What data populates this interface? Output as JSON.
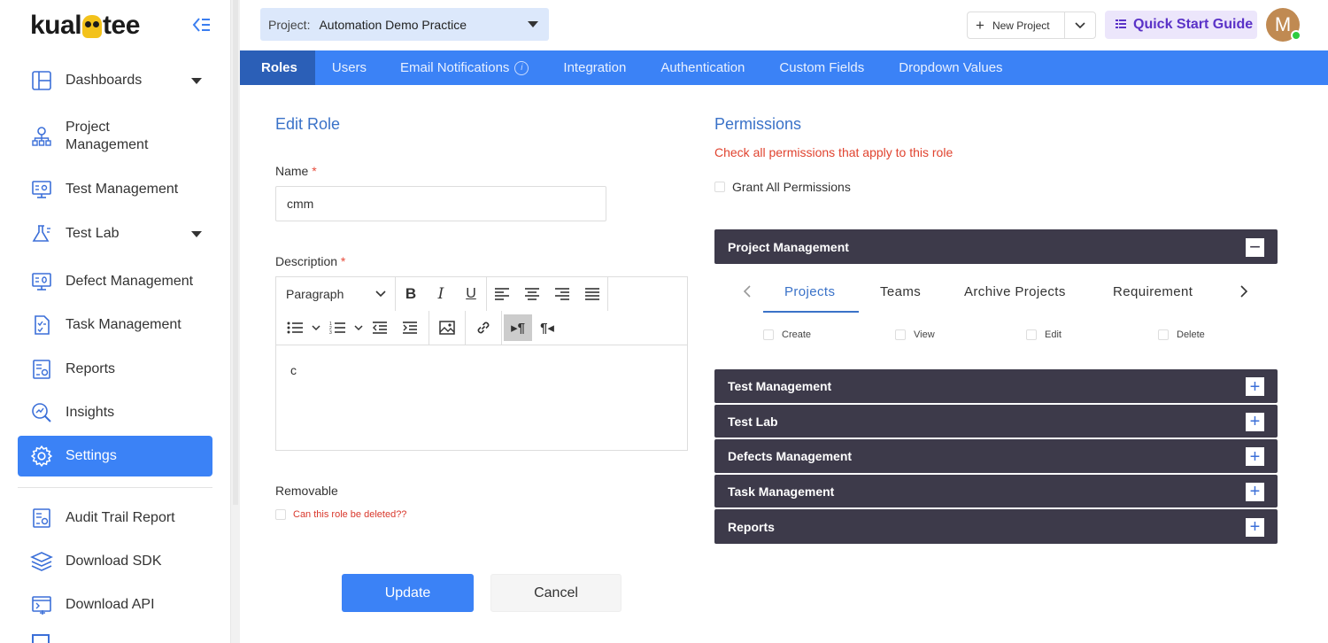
{
  "logo": {
    "text_before": "kual",
    "text_after": "tee"
  },
  "sidebar": {
    "items": [
      {
        "label": "Dashboards",
        "icon": "dashboard-icon",
        "has_caret": true
      },
      {
        "label": "Project\nManagement",
        "icon": "hierarchy-icon"
      },
      {
        "label": "Test Management",
        "icon": "monitor-settings-icon"
      },
      {
        "label": "Test Lab",
        "icon": "flask-icon",
        "has_caret": true
      },
      {
        "label": "Defect Management",
        "icon": "monitor-bug-icon"
      },
      {
        "label": "Task Management",
        "icon": "checklist-icon"
      },
      {
        "label": "Reports",
        "icon": "report-icon"
      },
      {
        "label": "Insights",
        "icon": "magnifier-chart-icon"
      },
      {
        "label": "Settings",
        "icon": "gear-icon",
        "active": true
      },
      {
        "label": "Audit Trail Report",
        "icon": "report-icon"
      },
      {
        "label": "Download SDK",
        "icon": "layers-icon"
      },
      {
        "label": "Download API",
        "icon": "terminal-icon"
      }
    ]
  },
  "header": {
    "project_label": "Project:",
    "project_value": "Automation Demo Practice",
    "new_project": "New Project",
    "quick_start": "Quick Start Guide",
    "avatar_initial": "M"
  },
  "tabs": [
    "Roles",
    "Users",
    "Email Notifications",
    "Integration",
    "Authentication",
    "Custom Fields",
    "Dropdown Values"
  ],
  "active_tab": "Roles",
  "edit_role": {
    "title": "Edit Role",
    "name_label": "Name",
    "name_value": "cmm",
    "description_label": "Description",
    "paragraph_select": "Paragraph",
    "description_value": "c",
    "removable_label": "Removable",
    "removable_question": "Can this role be deleted??",
    "update": "Update",
    "cancel": "Cancel"
  },
  "permissions": {
    "title": "Permissions",
    "subtitle": "Check all permissions that apply to this role",
    "grant_all": "Grant All Permissions",
    "expanded_section": "Project Management",
    "subtabs": [
      "Projects",
      "Teams",
      "Archive Projects",
      "Requirement"
    ],
    "active_subtab": "Projects",
    "checks": [
      "Create",
      "View",
      "Edit",
      "Delete"
    ],
    "collapsed_sections": [
      "Test Management",
      "Test Lab",
      "Defects Management",
      "Task Management",
      "Reports"
    ]
  },
  "colors": {
    "accent": "#3b82f6",
    "accent_dark": "#2b5fb7",
    "panel": "#3d3a4a",
    "danger": "#e0432f"
  }
}
